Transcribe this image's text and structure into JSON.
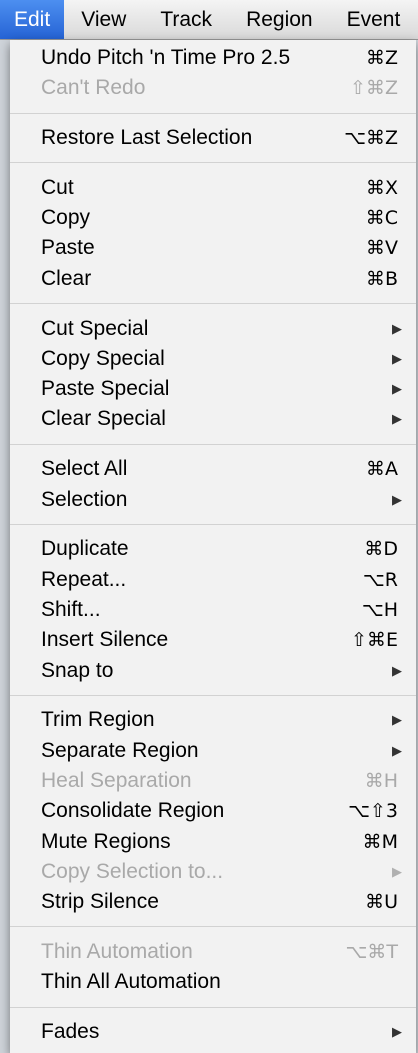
{
  "menubar": {
    "items": [
      "Edit",
      "View",
      "Track",
      "Region",
      "Event"
    ]
  },
  "menu": {
    "groups": [
      [
        {
          "label": "Undo Pitch 'n Time Pro 2.5",
          "shortcut": "⌘Z",
          "enabled": true
        },
        {
          "label": "Can't Redo",
          "shortcut": "⇧⌘Z",
          "enabled": false
        }
      ],
      [
        {
          "label": "Restore Last Selection",
          "shortcut": "⌥⌘Z",
          "enabled": true
        }
      ],
      [
        {
          "label": "Cut",
          "shortcut": "⌘X",
          "enabled": true
        },
        {
          "label": "Copy",
          "shortcut": "⌘C",
          "enabled": true
        },
        {
          "label": "Paste",
          "shortcut": "⌘V",
          "enabled": true
        },
        {
          "label": "Clear",
          "shortcut": "⌘B",
          "enabled": true
        }
      ],
      [
        {
          "label": "Cut Special",
          "submenu": true,
          "enabled": true
        },
        {
          "label": "Copy Special",
          "submenu": true,
          "enabled": true
        },
        {
          "label": "Paste Special",
          "submenu": true,
          "enabled": true
        },
        {
          "label": "Clear Special",
          "submenu": true,
          "enabled": true
        }
      ],
      [
        {
          "label": "Select All",
          "shortcut": "⌘A",
          "enabled": true
        },
        {
          "label": "Selection",
          "submenu": true,
          "enabled": true
        }
      ],
      [
        {
          "label": "Duplicate",
          "shortcut": "⌘D",
          "enabled": true
        },
        {
          "label": "Repeat...",
          "shortcut": "⌥R",
          "enabled": true
        },
        {
          "label": "Shift...",
          "shortcut": "⌥H",
          "enabled": true
        },
        {
          "label": "Insert Silence",
          "shortcut": "⇧⌘E",
          "enabled": true
        },
        {
          "label": "Snap to",
          "submenu": true,
          "enabled": true
        }
      ],
      [
        {
          "label": "Trim Region",
          "submenu": true,
          "enabled": true
        },
        {
          "label": "Separate Region",
          "submenu": true,
          "enabled": true
        },
        {
          "label": "Heal Separation",
          "shortcut": "⌘H",
          "enabled": false
        },
        {
          "label": "Consolidate Region",
          "shortcut": "⌥⇧3",
          "enabled": true
        },
        {
          "label": "Mute Regions",
          "shortcut": "⌘M",
          "enabled": true
        },
        {
          "label": "Copy Selection to...",
          "submenu": true,
          "enabled": false
        },
        {
          "label": "Strip Silence",
          "shortcut": "⌘U",
          "enabled": true
        }
      ],
      [
        {
          "label": "Thin Automation",
          "shortcut": "⌥⌘T",
          "enabled": false
        },
        {
          "label": "Thin All Automation",
          "enabled": true
        }
      ],
      [
        {
          "label": "Fades",
          "submenu": true,
          "enabled": true
        }
      ]
    ]
  },
  "icons": {
    "submenu_arrow": "▶"
  },
  "colors": {
    "highlight": "#2d6fdc",
    "disabled_text": "#a9a9a9",
    "menu_bg": "#f2f2f2"
  }
}
